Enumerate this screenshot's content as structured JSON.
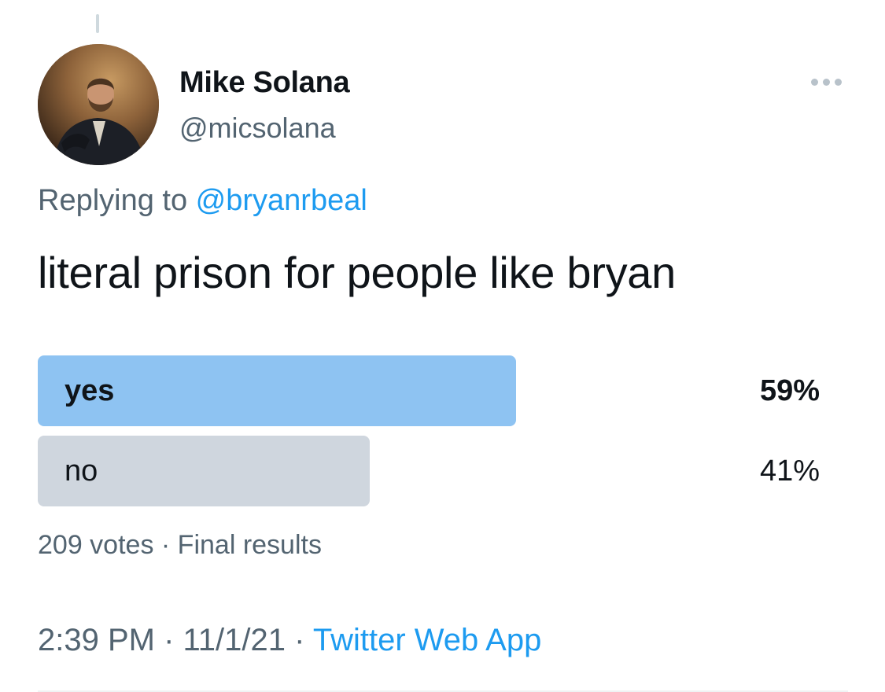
{
  "author": {
    "display_name": "Mike Solana",
    "handle": "@micsolana"
  },
  "reply": {
    "prefix": "Replying to ",
    "mention": "@bryanrbeal"
  },
  "tweet": {
    "text": "literal prison for people like bryan"
  },
  "poll": {
    "options": [
      {
        "label": "yes",
        "percent_text": "59%",
        "percent": 59,
        "leading": true
      },
      {
        "label": "no",
        "percent_text": "41%",
        "percent": 41,
        "leading": false
      }
    ],
    "votes_text": "209 votes",
    "separator": " · ",
    "status_text": "Final results"
  },
  "meta": {
    "time": "2:39 PM",
    "date": "11/1/21",
    "separator": " · ",
    "source": "Twitter Web App"
  },
  "icons": {
    "more": "more-horizontal-icon",
    "avatar": "avatar-portrait"
  },
  "colors": {
    "accent": "#1d9bf0",
    "poll_leading": "#8ec3f2",
    "poll_other": "#cfd6de",
    "secondary_text": "#536471"
  }
}
